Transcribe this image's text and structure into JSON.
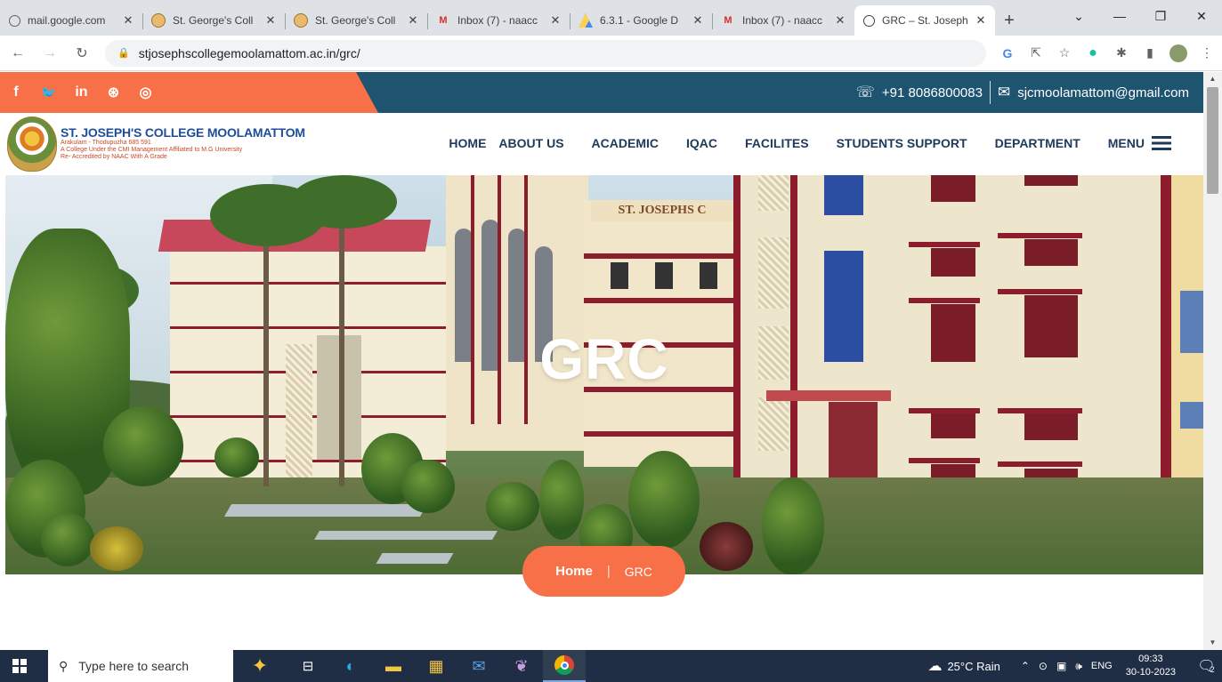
{
  "browser": {
    "tabs": [
      {
        "title": "mail.google.com",
        "icon": "globe-icon"
      },
      {
        "title": "St. George's Coll",
        "icon": "college-seal-icon"
      },
      {
        "title": "St. George's Coll",
        "icon": "college-seal-icon"
      },
      {
        "title": "Inbox (7) - naacc",
        "icon": "gmail-icon"
      },
      {
        "title": "6.3.1 - Google D",
        "icon": "google-drive-icon"
      },
      {
        "title": "Inbox (7) - naacc",
        "icon": "gmail-icon"
      },
      {
        "title": "GRC – St. Joseph",
        "icon": "globe-icon",
        "active": true
      }
    ],
    "close_glyph": "✕",
    "new_tab_glyph": "+",
    "url": "stjosephscollegemoolamattom.ac.in/grc/"
  },
  "site": {
    "social": [
      "f",
      "🐦",
      "in",
      "⊛",
      "◎"
    ],
    "phone": "+91 8086800083",
    "email": "sjcmoolamattom@gmail.com",
    "logo": {
      "name": "ST. JOSEPH'S COLLEGE MOOLAMATTOM",
      "line1": "Arakulam - Thodupuzha 685 591",
      "line2": "A College Under the CMI Management Affiliated to M.G University",
      "line3": "Re- Accredited by NAAC With A Grade"
    },
    "nav": [
      "HOME",
      "ABOUT US",
      "ACADEMIC",
      "IQAC",
      "FACILITES",
      "STUDENTS SUPPORT",
      "DEPARTMENT",
      "MENU"
    ],
    "hero": {
      "title": "GRC",
      "sign": "ST. JOSEPHS C"
    },
    "breadcrumb": {
      "home": "Home",
      "separator": "|",
      "current": "GRC"
    },
    "colors": {
      "accent_orange": "#f87048",
      "topbar_blue": "#1e5470",
      "nav_text": "#1e3a5a"
    }
  },
  "taskbar": {
    "search_placeholder": "Type here to search",
    "weather": "25°C  Rain",
    "language": "ENG",
    "time": "09:33",
    "date": "30-10-2023",
    "notification_count": "2"
  }
}
